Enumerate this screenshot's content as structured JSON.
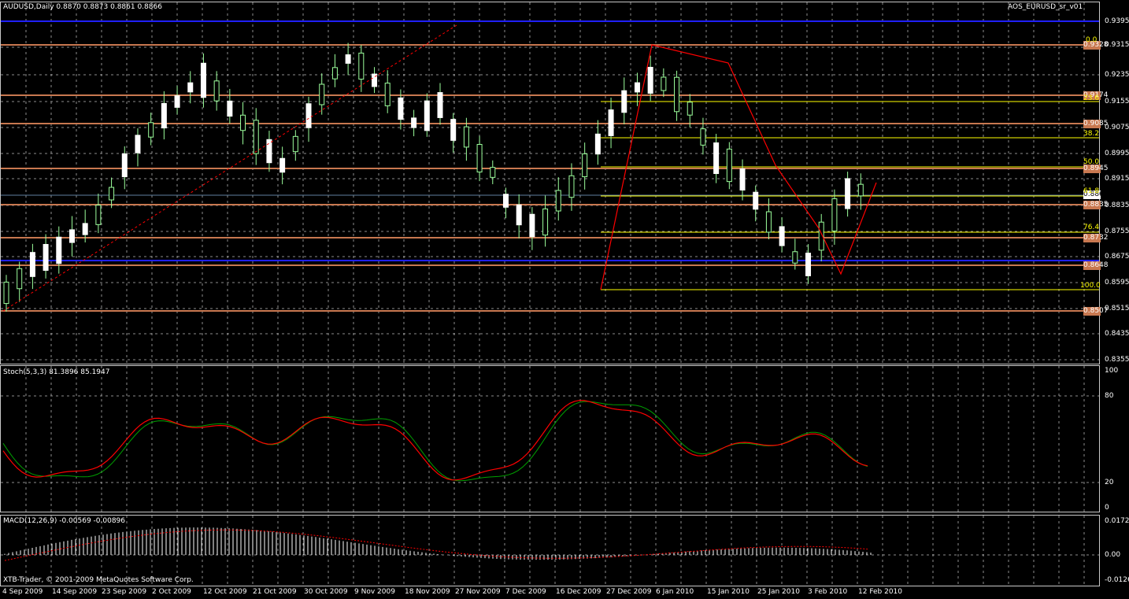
{
  "main": {
    "symbol_header": "AUDUSD,Daily  0.8870 0.8873 0.8861 0.8866",
    "indicator_label": "AOS_EURUSD_sr_v01",
    "price_ticks": [
      "0.9395",
      "0.9315",
      "0.9235",
      "0.9155",
      "0.9075",
      "0.8995",
      "0.8915",
      "0.8835",
      "0.8755",
      "0.8675",
      "0.8595",
      "0.8515",
      "0.8435",
      "0.8355"
    ],
    "level_boxes": [
      {
        "label": "0.9328",
        "color": "#c87850"
      },
      {
        "label": "0.9174",
        "color": "#c87850"
      },
      {
        "label": "0.9085",
        "color": "#c87850"
      },
      {
        "label": "0.8945",
        "color": "#c87850"
      },
      {
        "label": "0.8866",
        "color": "#ffffff"
      },
      {
        "label": "0.8835",
        "color": "#c87850"
      },
      {
        "label": "0.8732",
        "color": "#c87850"
      },
      {
        "label": "0.8648",
        "color": "#c87850"
      },
      {
        "label": "0.8507",
        "color": "#c87850"
      }
    ],
    "fib_labels": [
      "0.0",
      "23.6",
      "38.2",
      "50.0",
      "61.8",
      "76.4",
      "100.0"
    ]
  },
  "stoch": {
    "label": "Stoch(5,3,3) 81.3896 85.1947",
    "ticks": [
      "100",
      "80",
      "20",
      "0"
    ]
  },
  "macd": {
    "label": "MACD(12,26,9) -0.00569 -0.00896",
    "ticks": [
      "0.01725",
      "0.00",
      "-0.01269"
    ]
  },
  "footer": {
    "copyright": "XTB-Trader, © 2001-2009 MetaQuotes Software Corp."
  },
  "dates": [
    "4 Sep 2009",
    "14 Sep 2009",
    "23 Sep 2009",
    "2 Oct 2009",
    "12 Oct 2009",
    "21 Oct 2009",
    "30 Oct 2009",
    "9 Nov 2009",
    "18 Nov 2009",
    "27 Nov 2009",
    "7 Dec 2009",
    "16 Dec 2009",
    "27 Dec 2009",
    "6 Jan 2010",
    "15 Jan 2010",
    "25 Jan 2010",
    "3 Feb 2010",
    "12 Feb 2010"
  ],
  "colors": {
    "bull": "#9cff9c",
    "bear": "#ffffff",
    "level": "#c87850",
    "blue_level": "#2020ff",
    "fib": "#ffff00",
    "stoch_main": "#00a000",
    "stoch_signal": "#ff0000",
    "grid": "#c8c8c8",
    "zigzag": "#ff0000"
  }
}
